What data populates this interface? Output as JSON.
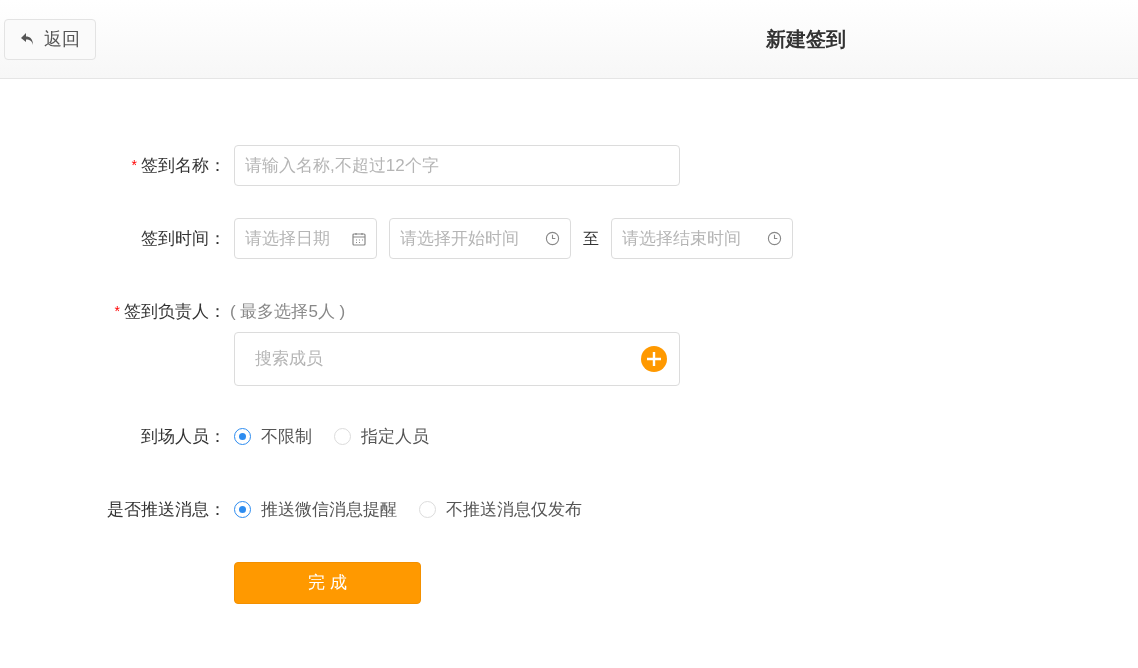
{
  "header": {
    "back_label": "返回",
    "title": "新建签到"
  },
  "rows": [
    {
      "kind": "text",
      "required_mark": "*",
      "label": "签到名称：",
      "placeholder": "请输入名称,不超过12个字"
    },
    {
      "kind": "time",
      "label": "签到时间：",
      "date_placeholder": "请选择日期",
      "start_placeholder": "请选择开始时间",
      "separator": "至",
      "end_placeholder": "请选择结束时间"
    },
    {
      "kind": "members",
      "required_mark": "*",
      "label": "签到负责人：",
      "hint": "( 最多选择5人 )",
      "placeholder": "搜索成员"
    },
    {
      "kind": "radio",
      "label": "到场人员：",
      "options": [
        {
          "label": "不限制",
          "selected": true
        },
        {
          "label": "指定人员",
          "selected": false
        }
      ]
    },
    {
      "kind": "radio",
      "label": "是否推送消息：",
      "options": [
        {
          "label": "推送微信消息提醒",
          "selected": true
        },
        {
          "label": "不推送消息仅发布",
          "selected": false
        }
      ]
    }
  ],
  "submit_label": "完 成"
}
